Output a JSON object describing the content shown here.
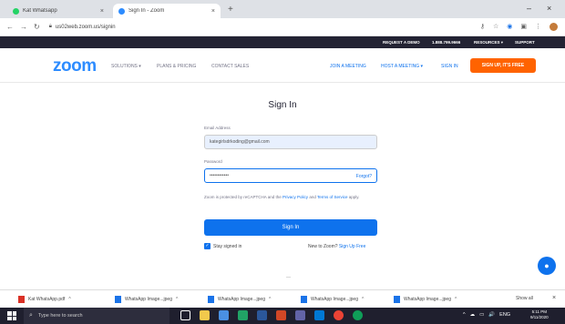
{
  "browser": {
    "tabs": [
      {
        "label": "Kat Whatsapp",
        "favicon_color": "#25d366"
      },
      {
        "label": "Sign In - Zoom",
        "favicon_color": "#2d8cff"
      }
    ],
    "new_tab": "+",
    "tab_close": "×",
    "url": "us02web.zoom.us/signin",
    "window_minimize": "–",
    "window_close": "×"
  },
  "zoom_topstrip": {
    "items": [
      "REQUEST A DEMO",
      "1.888.799.9666",
      "RESOURCES ▾",
      "SUPPORT"
    ]
  },
  "zoom_header": {
    "logo": "zoom",
    "nav_left": [
      "SOLUTIONS ▾",
      "PLANS & PRICING",
      "CONTACT SALES"
    ],
    "nav_right": [
      "JOIN A MEETING",
      "HOST A MEETING ▾",
      "SIGN IN"
    ],
    "signup_button": "SIGN UP, IT'S FREE"
  },
  "signin": {
    "title": "Sign In",
    "email_label": "Email Address",
    "email_value": "kategirlsdrkoding@gmail.com",
    "password_label": "Password",
    "password_value": "••••••••••••",
    "forgot_link": "Forgot?",
    "legal_prefix": "Zoom is protected by reCAPTCHA and the ",
    "legal_privacy": "Privacy Policy",
    "legal_and": " and ",
    "legal_terms": "Terms of Service",
    "legal_suffix": " apply.",
    "signin_button": "Sign In",
    "stay_signed_in": "Stay signed in",
    "stay_checked": true,
    "new_to_zoom": "New to Zoom? ",
    "signup_free": "Sign Up Free",
    "dash": "—"
  },
  "downloads": {
    "items": [
      {
        "name": "Kat WhatsApp.pdf",
        "color": "#d93025"
      },
      {
        "name": "WhatsApp Image...jpeg",
        "color": "#1a73e8"
      },
      {
        "name": "WhatsApp Image...jpeg",
        "color": "#1a73e8"
      },
      {
        "name": "WhatsApp Image...jpeg",
        "color": "#1a73e8"
      },
      {
        "name": "WhatsApp Image...jpeg",
        "color": "#1a73e8"
      }
    ],
    "caret": "^",
    "show_all": "Show all",
    "close": "×"
  },
  "taskbar": {
    "search_placeholder": "Type here to search",
    "apps": [
      {
        "name": "task-view",
        "color": "#ffffff"
      },
      {
        "name": "file-explorer",
        "color": "#f2c94c"
      },
      {
        "name": "mail",
        "color": "#4a90e2"
      },
      {
        "name": "excel",
        "color": "#21a366"
      },
      {
        "name": "word",
        "color": "#2b579a"
      },
      {
        "name": "powerpoint",
        "color": "#d24726"
      },
      {
        "name": "teams",
        "color": "#6264a7"
      },
      {
        "name": "outlook",
        "color": "#0078d4"
      },
      {
        "name": "chrome",
        "color": "#ea4335"
      },
      {
        "name": "edge",
        "color": "#0f9d58"
      }
    ],
    "tray": [
      "^",
      "☁",
      "▭",
      "🔊",
      "ENG"
    ],
    "time": "5:11 PM",
    "date": "9/11/2020"
  },
  "colors": {
    "zoom_blue": "#0e72ed",
    "zoom_orange": "#ff6300",
    "topstrip_bg": "#232333"
  }
}
